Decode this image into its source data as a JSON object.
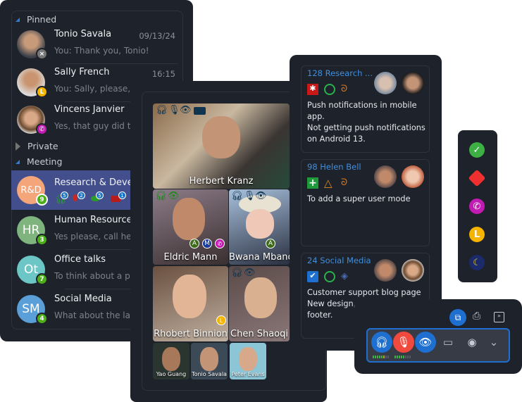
{
  "chat_list": {
    "sections": {
      "pinned": "Pinned",
      "private": "Private",
      "meeting": "Meeting"
    },
    "pinned": [
      {
        "name": "Tonio Savala",
        "time": "09/13/24",
        "preview": "You: Thank you, Tonio!",
        "status": "offline"
      },
      {
        "name": "Sally French",
        "time": "16:15",
        "preview": "You: Sally, please, ch",
        "status": "away"
      },
      {
        "name": "Vincens Janvier",
        "time": "",
        "preview": "Yes, that guy did the",
        "status": "on-call"
      }
    ],
    "meetings": [
      {
        "initials": "R&D",
        "name": "Research & Develop",
        "count": "9",
        "color": "#f4a57a",
        "active": true,
        "indicators": {
          "headphones": "5",
          "mic": "2",
          "eye": "5",
          "camera": "1"
        }
      },
      {
        "initials": "HR",
        "name": "Human Resources",
        "count": "3",
        "color": "#7fb47f",
        "preview": "Yes please, call her a"
      },
      {
        "initials": "Ot",
        "name": "Office talks",
        "count": "7",
        "color": "#6cc6c6",
        "preview": "To think about a pre"
      },
      {
        "initials": "SM",
        "name": "Social Media",
        "count": "4",
        "color": "#5b9fd8",
        "preview": "What about the late"
      }
    ]
  },
  "video_call": {
    "main": {
      "name": "Herbert Kranz"
    },
    "tiles": [
      {
        "name": "Eldric Mann",
        "badges": [
          "A",
          "M"
        ]
      },
      {
        "name": "Bwana Mbano",
        "badges": [
          "A"
        ]
      },
      {
        "name": "Rhobert Binnion"
      },
      {
        "name": "Chen Shaoqi"
      }
    ],
    "small_tiles": [
      {
        "name": "Yao Guang"
      },
      {
        "name": "Tonio Savala"
      },
      {
        "name": "Peter Evans"
      }
    ]
  },
  "tasks": [
    {
      "title": "128 Research ...",
      "text": [
        "Push notifications in mobile app.",
        "Not getting push notifications on Android 13."
      ],
      "icons": [
        "bug-icon",
        "circle-status-icon",
        "assignee-icon"
      ]
    },
    {
      "title": "98 Helen Bell",
      "text": [
        "To add a super user mode"
      ],
      "icons": [
        "plus-icon",
        "triangle-priority-icon",
        "assignee-icon"
      ]
    },
    {
      "title": "24 Social Media",
      "text": [
        "Customer support blog page",
        "New design,",
        "footer."
      ],
      "icons": [
        "checkbox-icon",
        "circle-status-icon",
        "layers-icon"
      ]
    }
  ],
  "status_menu": [
    "available",
    "do-not-disturb",
    "on-call",
    "away",
    "night"
  ],
  "colors": {
    "accent": "#2f7bd6",
    "panel": "#1e222a",
    "active_row": "#434f8c",
    "green": "#4caf1a",
    "red": "#f04a3e"
  },
  "call_controls": {
    "headphones": "on",
    "mic": "on",
    "camera": "off",
    "mic_level": 0.6,
    "headphone_level": 0.75
  }
}
